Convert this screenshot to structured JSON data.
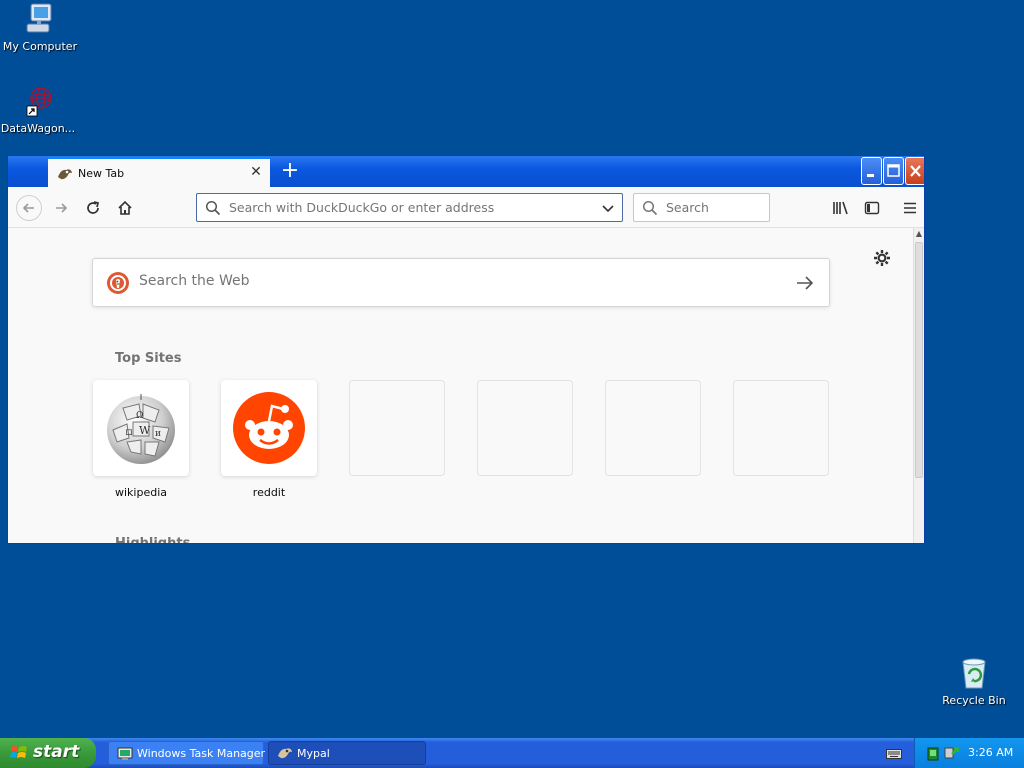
{
  "desktop": {
    "icons": [
      {
        "label": "My Computer"
      },
      {
        "label": "DataWagon..."
      },
      {
        "label": "Recycle Bin"
      }
    ]
  },
  "browser": {
    "tab": {
      "title": "New Tab",
      "favicon": "mypal-icon"
    },
    "urlbar": {
      "placeholder": "Search with DuckDuckGo or enter address"
    },
    "searchbar": {
      "placeholder": "Search"
    },
    "newtab": {
      "web_search_placeholder": "Search the Web",
      "top_sites_title": "Top Sites",
      "top_sites": [
        {
          "label": "wikipedia",
          "icon": "wikipedia-globe-icon"
        },
        {
          "label": "reddit",
          "icon": "reddit-alien-icon"
        },
        {
          "label": ""
        },
        {
          "label": ""
        },
        {
          "label": ""
        },
        {
          "label": ""
        }
      ],
      "highlights_title": "Highlights"
    }
  },
  "taskbar": {
    "start_label": "start",
    "tasks": [
      {
        "label": "Windows Task Manager"
      },
      {
        "label": "Mypal"
      }
    ],
    "clock": "3:26 AM"
  },
  "colors": {
    "desktop": "#004e98",
    "taskbar": "#245edb",
    "start": "#3a9a3a",
    "reddit": "#ff4500",
    "accent": "#0a84ff"
  }
}
